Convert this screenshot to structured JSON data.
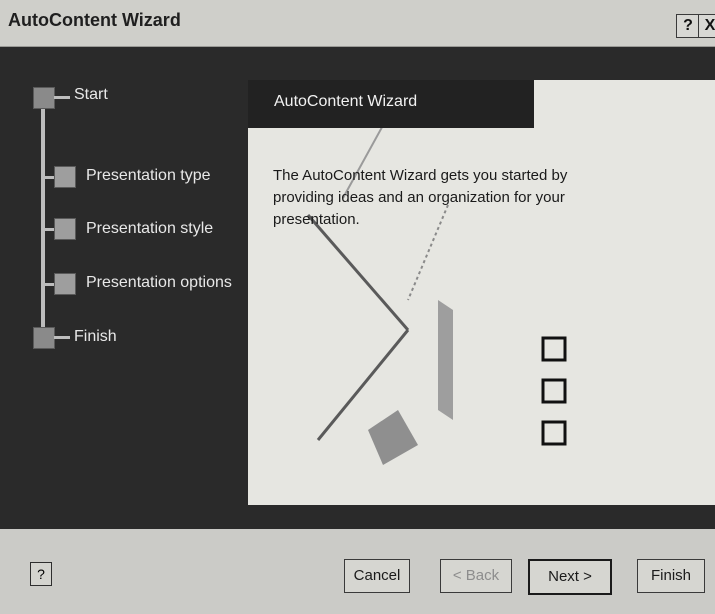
{
  "window": {
    "title": "AutoContent Wizard",
    "help_button": "?",
    "close_button": "X"
  },
  "steps": [
    {
      "label": "Start"
    },
    {
      "label": "Presentation type"
    },
    {
      "label": "Presentation style"
    },
    {
      "label": "Presentation options"
    },
    {
      "label": "Finish"
    }
  ],
  "panel": {
    "title": "AutoContent Wizard",
    "description": "The AutoContent Wizard gets you started by providing ideas and an organization for your presentation."
  },
  "footer": {
    "help": "?",
    "cancel": "Cancel",
    "back": "< Back",
    "next": "Next >",
    "finish": "Finish"
  }
}
